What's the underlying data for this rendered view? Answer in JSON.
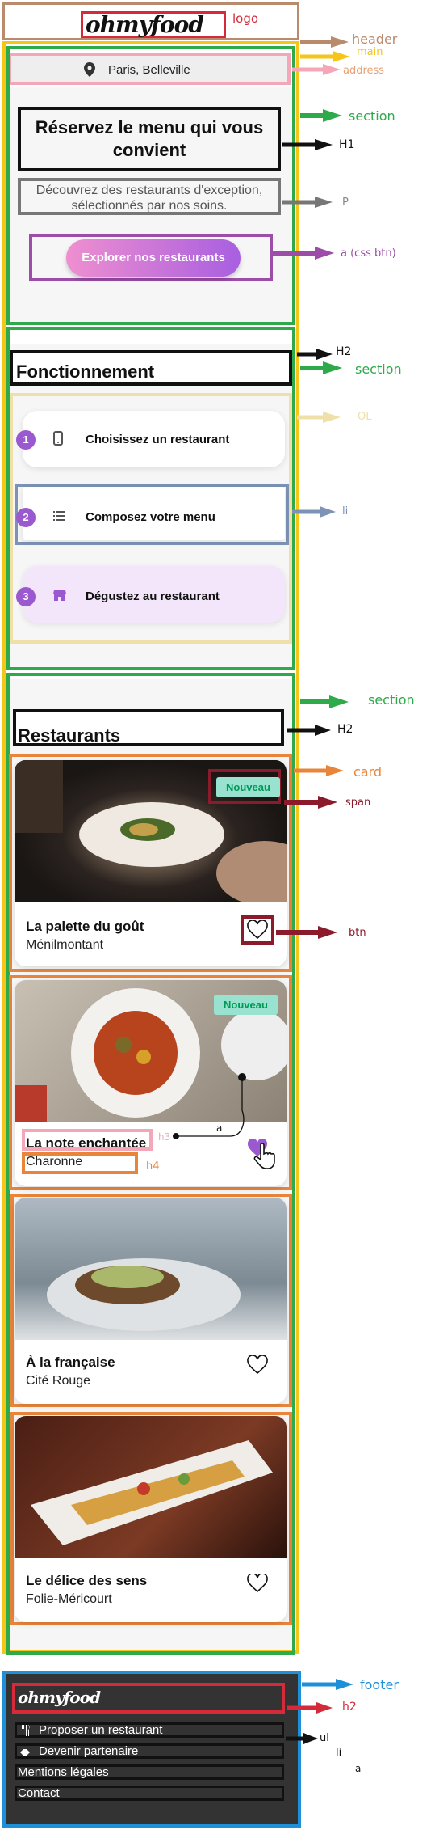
{
  "header": {
    "logo_text": "ohmyfood"
  },
  "address": {
    "text": "Paris, Belleville"
  },
  "hero": {
    "title": "Réservez le menu qui vous convient",
    "subtitle": "Découvrez des restaurants d'exception, sélectionnés par nos soins.",
    "cta": "Explorer nos restaurants"
  },
  "how": {
    "title": "Fonctionnement",
    "steps": [
      {
        "num": "1",
        "label": "Choisissez un restaurant",
        "icon": "mobile-icon"
      },
      {
        "num": "2",
        "label": "Composez votre menu",
        "icon": "list-icon"
      },
      {
        "num": "3",
        "label": "Dégustez au restaurant",
        "icon": "store-icon"
      }
    ]
  },
  "restaurants": {
    "title": "Restaurants",
    "badge": "Nouveau",
    "items": [
      {
        "name": "La palette du goût",
        "area": "Ménilmontant",
        "new": true,
        "liked": false
      },
      {
        "name": "La note enchantée",
        "area": "Charonne",
        "new": true,
        "liked": true
      },
      {
        "name": "À la française",
        "area": "Cité Rouge",
        "new": false,
        "liked": false
      },
      {
        "name": "Le délice des sens",
        "area": "Folie-Méricourt",
        "new": false,
        "liked": false
      }
    ]
  },
  "footer": {
    "logo_text": "ohmyfood",
    "links": [
      "Proposer un restaurant",
      "Devenir partenaire",
      "Mentions légales",
      "Contact"
    ]
  },
  "annotations": {
    "logo": "logo",
    "header": "header",
    "main": "main",
    "address": "address",
    "section": "section",
    "h1": "H1",
    "p": "P",
    "a_btn": "a (css btn)",
    "h2": "H2",
    "ol": "OL",
    "li": "li",
    "card": "card",
    "span": "span",
    "btn": "btn",
    "h3": "h3",
    "a": "a",
    "h4": "h4",
    "footer": "footer",
    "h2_lower": "h2",
    "ul": "ul"
  },
  "colors": {
    "header_outline": "#b98a6b",
    "main_outline": "#f5c518",
    "address_outline": "#f4a7b9",
    "section_outline": "#2faa4a",
    "footer_outline": "#1e90d8",
    "card_outline": "#e8853a",
    "logo_outline": "#d42a3a",
    "purple_accent": "#9b59d0",
    "li_outline": "#7c93b5",
    "ol_outline": "#eee0a8"
  }
}
